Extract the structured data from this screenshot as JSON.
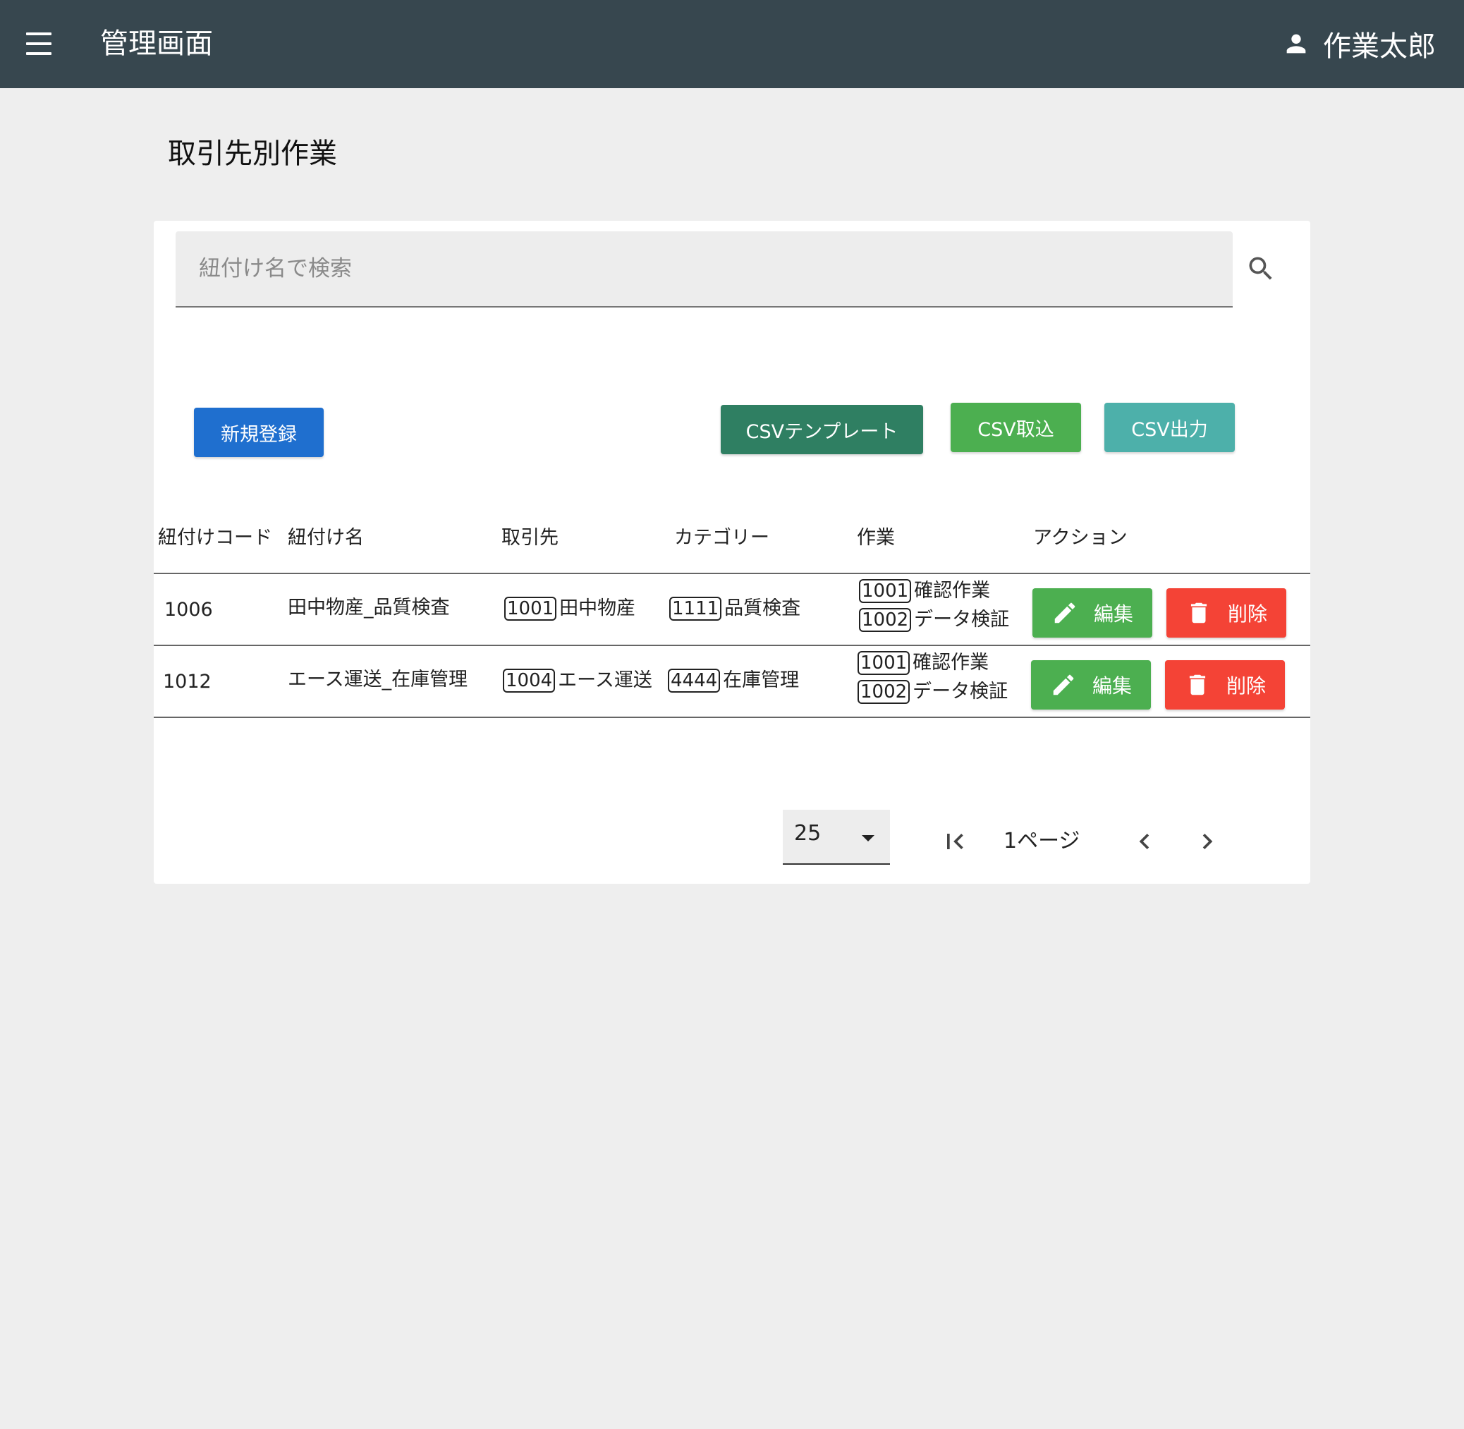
{
  "appbar": {
    "title": "管理画面",
    "user_name": "作業太郎",
    "background": "#37474f"
  },
  "page": {
    "title": "取引先別作業"
  },
  "search": {
    "placeholder": "紐付け名で検索",
    "value": ""
  },
  "actions": {
    "new_label": "新規登録",
    "csv_template_label": "CSVテンプレート",
    "csv_import_label": "CSV取込",
    "csv_export_label": "CSV出力"
  },
  "table": {
    "headers": [
      "紐付けコード",
      "紐付け名",
      "取引先",
      "カテゴリー",
      "作業",
      "アクション"
    ],
    "rows": [
      {
        "code": "1006",
        "name": "田中物産_品質検査",
        "partner_code": "1001",
        "partner_name": "田中物産",
        "category_code": "1111",
        "category_name": "品質検査",
        "tasks": [
          {
            "code": "1001",
            "name": "確認作業"
          },
          {
            "code": "1002",
            "name": "データ検証"
          }
        ],
        "edit_label": "編集",
        "delete_label": "削除"
      },
      {
        "code": "1012",
        "name": "エース運送_在庫管理",
        "partner_code": "1004",
        "partner_name": "エース運送",
        "category_code": "4444",
        "category_name": "在庫管理",
        "tasks": [
          {
            "code": "1001",
            "name": "確認作業"
          },
          {
            "code": "1002",
            "name": "データ検証"
          }
        ],
        "edit_label": "編集",
        "delete_label": "削除"
      }
    ]
  },
  "pagination": {
    "rows_per_page": "25",
    "page_label": "1ページ"
  },
  "colors": {
    "primary": "#1f6fcf",
    "template": "#2f7f62",
    "import": "#4caf50",
    "export": "#4db0aa",
    "edit": "#4caf50",
    "delete": "#f44336"
  }
}
